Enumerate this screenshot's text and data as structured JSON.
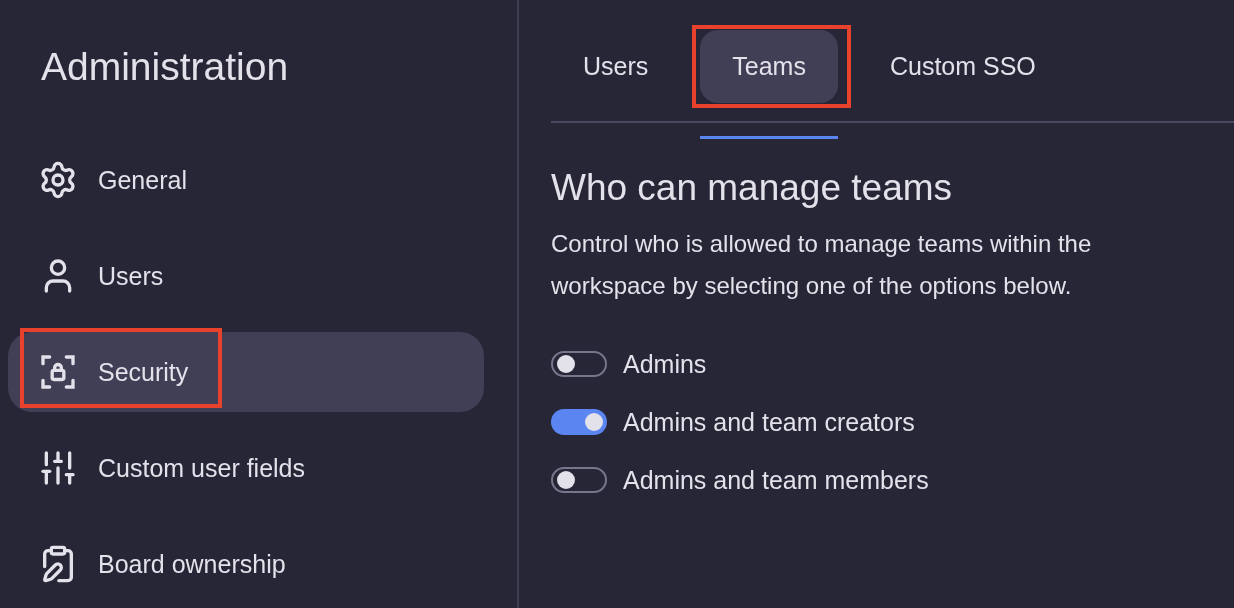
{
  "sidebar": {
    "title": "Administration",
    "items": [
      {
        "label": "General",
        "kind": "gear",
        "selected": false,
        "highlighted": false
      },
      {
        "label": "Users",
        "kind": "user",
        "selected": false,
        "highlighted": false
      },
      {
        "label": "Security",
        "kind": "lock",
        "selected": true,
        "highlighted": true
      },
      {
        "label": "Custom user fields",
        "kind": "sliders",
        "selected": false,
        "highlighted": false
      },
      {
        "label": "Board ownership",
        "kind": "clipboard",
        "selected": false,
        "highlighted": false
      }
    ]
  },
  "tabs": [
    {
      "label": "Users",
      "selected": false,
      "highlighted": false
    },
    {
      "label": "Teams",
      "selected": true,
      "highlighted": true
    },
    {
      "label": "Custom SSO",
      "selected": false,
      "highlighted": false
    }
  ],
  "section": {
    "heading": "Who can manage teams",
    "description": "Control who is allowed to manage teams within the workspace by selecting one of the options below.",
    "options": [
      {
        "label": "Admins",
        "on": false
      },
      {
        "label": "Admins and team creators",
        "on": true
      },
      {
        "label": "Admins and team members",
        "on": false
      }
    ]
  }
}
